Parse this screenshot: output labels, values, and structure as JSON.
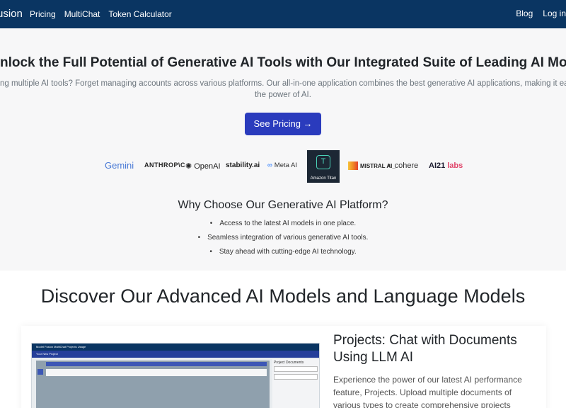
{
  "nav": {
    "brand": "usion",
    "links": [
      "Pricing",
      "MultiChat",
      "Token Calculator"
    ],
    "right": [
      "Blog",
      "Log in"
    ]
  },
  "hero": {
    "title": "nlock the Full Potential of Generative AI Tools with Our Integrated Suite of Leading AI Mode",
    "lead_line1": "ng multiple AI tools? Forget managing accounts across various platforms. Our all-in-one application combines the best generative AI applications, making it easier than ev",
    "lead_line2": "the power of AI.",
    "cta": "See Pricing →"
  },
  "logos": {
    "gemini": "Gemini",
    "anthropic": "ANTHROP\\C",
    "openai": "OpenAI",
    "stability": "stability.ai",
    "meta": "Meta AI",
    "titan": "Amazon Titan",
    "mistral": "MISTRAL AI_",
    "cohere": "cohere",
    "ai21": "AI21",
    "ai21_labs": "labs"
  },
  "why": {
    "title": "Why Choose Our Generative AI Platform?",
    "bullets": [
      "Access to the latest AI models in one place.",
      "Seamless integration of various generative AI tools.",
      "Stay ahead with cutting-edge AI technology."
    ]
  },
  "discover": {
    "title": "Discover Our Advanced AI Models and Language Models"
  },
  "projects": {
    "title": "Projects: Chat with Documents Using LLM AI",
    "desc": "Experience the power of our latest AI performance feature, Projects. Upload multiple documents of various types to create comprehensive projects"
  },
  "shot": {
    "nav": "Model Fusion   MultiChat   Projects   Usage",
    "sub": "Your New Project",
    "panel_title": "Project Documents"
  }
}
